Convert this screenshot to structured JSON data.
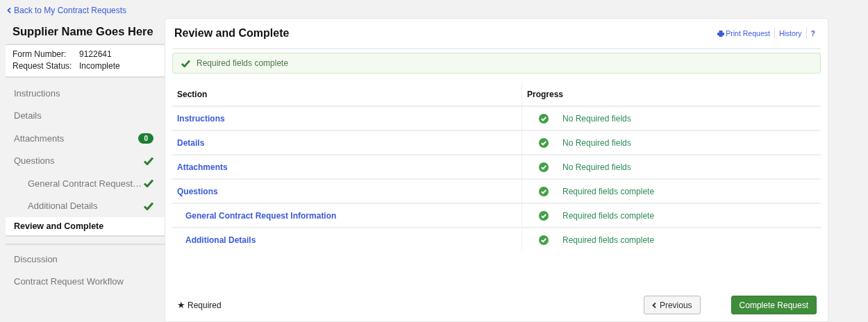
{
  "back_link": "Back to My Contract Requests",
  "sidebar": {
    "title": "Supplier Name Goes Here",
    "info": [
      {
        "label": "Form Number:",
        "value": "9122641"
      },
      {
        "label": "Request Status:",
        "value": "Incomplete"
      }
    ],
    "items": [
      {
        "label": "Instructions",
        "kind": "plain",
        "selected": false
      },
      {
        "label": "Details",
        "kind": "plain",
        "selected": false
      },
      {
        "label": "Attachments",
        "kind": "badge",
        "badge": "0",
        "selected": false
      },
      {
        "label": "Questions",
        "kind": "check",
        "selected": false,
        "children": [
          {
            "label": "General Contract Request…",
            "kind": "check",
            "selected": false
          },
          {
            "label": "Additional Details",
            "kind": "check",
            "selected": false
          }
        ]
      },
      {
        "label": "Review and Complete",
        "kind": "plain",
        "selected": true
      }
    ],
    "extra_items": [
      {
        "label": "Discussion",
        "selected": false
      },
      {
        "label": "Contract Request Workflow",
        "selected": false
      }
    ]
  },
  "main": {
    "title": "Review and Complete",
    "links": [
      {
        "label": "Print Request",
        "kind": "print"
      },
      {
        "label": "History",
        "kind": "text"
      },
      {
        "label": "?",
        "kind": "help"
      }
    ],
    "alert": "Required fields complete",
    "table": {
      "columns": [
        "Section",
        "Progress"
      ],
      "rows": [
        {
          "section": "Instructions",
          "progress": "No Required fields",
          "complete": true
        },
        {
          "section": "Details",
          "progress": "No Required fields",
          "complete": true
        },
        {
          "section": "Attachments",
          "progress": "No Required fields",
          "complete": true
        },
        {
          "section": "Questions",
          "progress": "Required fields complete",
          "complete": true,
          "children": [
            {
              "section": "General Contract Request Information",
              "progress": "Required fields complete",
              "complete": true
            },
            {
              "section": "Additional Details",
              "progress": "Required fields complete",
              "complete": true
            }
          ]
        }
      ]
    },
    "required_legend": {
      "mark": "★",
      "label": "Required"
    },
    "buttons": [
      {
        "label": "Previous",
        "kind": "secondary"
      },
      {
        "label": "Complete Request",
        "kind": "primary"
      }
    ]
  }
}
